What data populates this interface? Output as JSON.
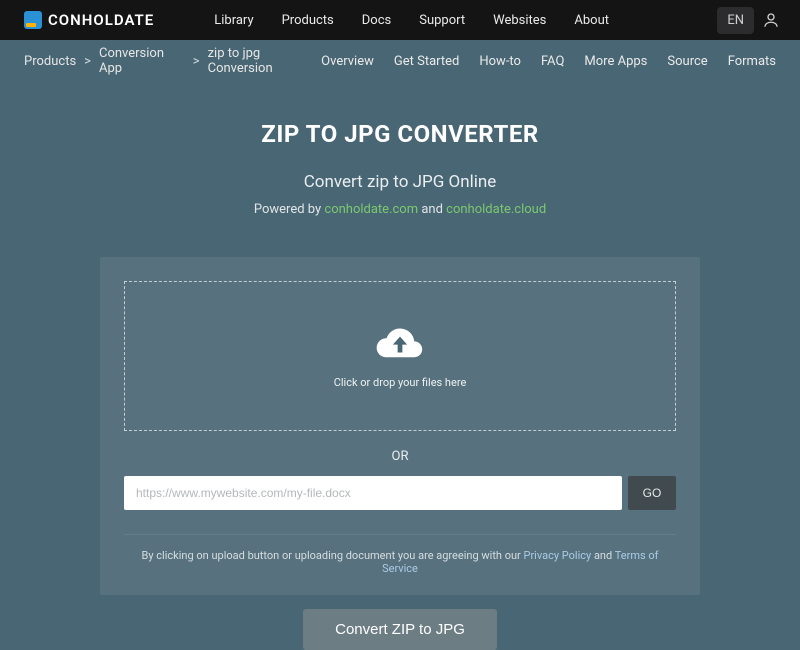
{
  "header": {
    "brand": "CONHOLDATE",
    "nav": {
      "library": "Library",
      "products": "Products",
      "docs": "Docs",
      "support": "Support",
      "websites": "Websites",
      "about": "About"
    },
    "lang": "EN"
  },
  "subnav": {
    "breadcrumb": {
      "products": "Products",
      "app": "Conversion App",
      "current": "zip to jpg Conversion"
    },
    "links": {
      "overview": "Overview",
      "get_started": "Get Started",
      "howto": "How-to",
      "faq": "FAQ",
      "more_apps": "More Apps",
      "source": "Source",
      "formats": "Formats"
    }
  },
  "hero": {
    "title": "ZIP TO JPG CONVERTER",
    "subtitle": "Convert zip to JPG Online",
    "powered_prefix": "Powered by ",
    "powered_link1": "conholdate.com",
    "powered_and": " and ",
    "powered_link2": "conholdate.cloud"
  },
  "upload": {
    "dropzone_text": "Click or drop your files here",
    "or_text": "OR",
    "url_placeholder": "https://www.mywebsite.com/my-file.docx",
    "url_value": "",
    "go_label": "GO",
    "agree_prefix": "By clicking on upload button or uploading document you are agreeing with our ",
    "privacy": "Privacy Policy",
    "agree_and": " and ",
    "terms": "Terms of Service"
  },
  "convert": {
    "label": "Convert ZIP to JPG"
  }
}
